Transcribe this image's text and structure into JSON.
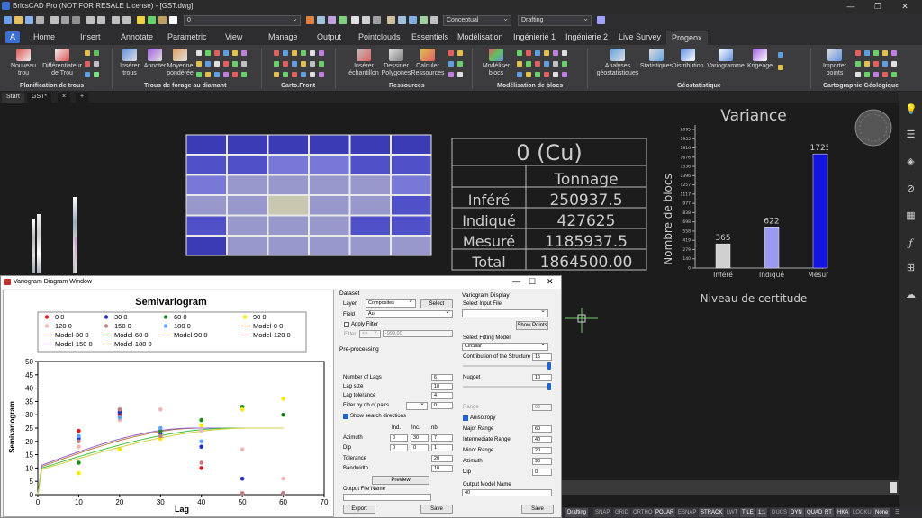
{
  "titlebar": {
    "title": "BricsCAD Pro (NOT FOR RESALE License) - [GST.dwg]"
  },
  "qat": {
    "layer": "0",
    "visual_style": "Conceptual",
    "workspace": "Drafting"
  },
  "tabs": [
    "Home",
    "Insert",
    "Annotate",
    "Parametric",
    "View",
    "Manage",
    "Output",
    "Pointclouds",
    "Essentiels",
    "Modélisation",
    "Ingénierie 1",
    "Ingénierie 2",
    "Live Survey",
    "Progeox"
  ],
  "app_button": "A",
  "ribbon": {
    "buttons": [
      {
        "label": "Nouveau\ntrou"
      },
      {
        "label": "Différentiateur\nde Trou"
      },
      {
        "label": "Insérer\ntrous"
      },
      {
        "label": "Annoter"
      },
      {
        "label": "Moyenne\npondérée"
      },
      {
        "label": "Insérer\néchantillon"
      },
      {
        "label": "Dessiner\nPolygones"
      },
      {
        "label": "Calculer\nRessources"
      },
      {
        "label": "Modéliser\nblocs"
      },
      {
        "label": "Analyses\ngéostatistiques"
      },
      {
        "label": "Statistiques"
      },
      {
        "label": "Distribution"
      },
      {
        "label": "Variogramme"
      },
      {
        "label": "Krigeage"
      },
      {
        "label": "Importer\npoints"
      }
    ],
    "groups": [
      "Planification de trous",
      "Trous de forage au diamant",
      "Carto.Front",
      "Ressources",
      "Modélisation de blocs",
      "Géostatistique",
      "Cartographie Géologique"
    ]
  },
  "doctabs": {
    "start": "Start",
    "active": "GST*",
    "close": "×",
    "add": "+"
  },
  "drawing": {
    "table": {
      "title": "0 (Cu)",
      "header": "Tonnage",
      "rows": [
        {
          "label": "Inféré",
          "value": "250937.5"
        },
        {
          "label": "Indiqué",
          "value": "427625"
        },
        {
          "label": "Mesuré",
          "value": "1185937.5"
        },
        {
          "label": "Total",
          "value": "1864500.00"
        }
      ]
    },
    "variance_chart": {
      "title": "Variance",
      "ylabel": "Nombre de blocs",
      "xlabel": "Niveau de certitude",
      "yticks": [
        "2095",
        "1955",
        "1816",
        "1676",
        "1536",
        "1396",
        "1257",
        "1117",
        "977",
        "838",
        "698",
        "558",
        "419",
        "279",
        "140",
        "0"
      ],
      "colors": [
        "#d0d0d0",
        "#9a9af0",
        "#1515e0"
      ],
      "chart_data": {
        "type": "bar",
        "categories": [
          "Inféré",
          "Indiqué",
          "Mesuré"
        ],
        "values": [
          365,
          622,
          1725
        ],
        "title": "Variance",
        "xlabel": "Niveau de certitude",
        "ylabel": "Nombre de blocs",
        "ylim": [
          0,
          2095
        ]
      }
    }
  },
  "rightbar": {
    "icons": [
      "bulb-icon",
      "sliders-icon",
      "cube-icon",
      "paperclip-icon",
      "grid-icon",
      "fx-icon",
      "structure-icon",
      "cloud-icon"
    ]
  },
  "statusbar": {
    "items": [
      "Drafting",
      "SNAP",
      "GRID",
      "ORTHO",
      "POLAR",
      "ESNAP",
      "STRACK",
      "LWT",
      "TILE",
      "1:1",
      "DUCS",
      "DYN",
      "QUAD",
      "RT",
      "HKA",
      "LOCKUI",
      "None"
    ]
  },
  "variogram_window": {
    "title": "Variogram Diagram Window",
    "chart": {
      "title": "Semivariogram",
      "xlabel": "Lag",
      "ylabel": "Semivariogram",
      "legend": [
        {
          "name": "0 0",
          "color": "#e41a1c",
          "kind": "dot"
        },
        {
          "name": "30 0",
          "color": "#1f2fd0",
          "kind": "dot"
        },
        {
          "name": "60 0",
          "color": "#1a8a1a",
          "kind": "dot"
        },
        {
          "name": "90 0",
          "color": "#ffe800",
          "kind": "dot"
        },
        {
          "name": "120 0",
          "color": "#f4b4b4",
          "kind": "dot"
        },
        {
          "name": "150 0",
          "color": "#c08080",
          "kind": "dot"
        },
        {
          "name": "180 0",
          "color": "#60a0ff",
          "kind": "dot"
        },
        {
          "name": "Model-0 0",
          "color": "#c08040",
          "kind": "line"
        },
        {
          "name": "Model-30 0",
          "color": "#9060d0",
          "kind": "line"
        },
        {
          "name": "Model-60 0",
          "color": "#40c040",
          "kind": "line"
        },
        {
          "name": "Model-90 0",
          "color": "#d0d040",
          "kind": "line"
        },
        {
          "name": "Model-120 0",
          "color": "#f0a0a0",
          "kind": "line"
        },
        {
          "name": "Model-150 0",
          "color": "#c0a0e0",
          "kind": "line"
        },
        {
          "name": "Model-180 0",
          "color": "#a0a040",
          "kind": "line"
        }
      ],
      "chart_data": {
        "type": "scatter",
        "title": "Semivariogram",
        "xlabel": "Lag",
        "ylabel": "Semivariogram",
        "xlim": [
          0,
          70
        ],
        "ylim": [
          0,
          50
        ],
        "xticks": [
          0,
          10,
          20,
          30,
          40,
          50,
          60,
          70
        ],
        "yticks": [
          0,
          5,
          10,
          15,
          20,
          25,
          30,
          35,
          40,
          45,
          50
        ],
        "series": [
          {
            "name": "0 0",
            "color": "#e41a1c",
            "points": [
              [
                10,
                24
              ],
              [
                20,
                30
              ],
              [
                30,
                21
              ],
              [
                40,
                10
              ],
              [
                50,
                0.5
              ],
              [
                60,
                0.5
              ]
            ]
          },
          {
            "name": "30 0",
            "color": "#1f2fd0",
            "points": [
              [
                10,
                21
              ],
              [
                20,
                31
              ],
              [
                30,
                23
              ],
              [
                40,
                18
              ],
              [
                50,
                6
              ],
              [
                60,
                0.5
              ]
            ]
          },
          {
            "name": "60 0",
            "color": "#1a8a1a",
            "points": [
              [
                10,
                12
              ],
              [
                20,
                17
              ],
              [
                30,
                24
              ],
              [
                40,
                28
              ],
              [
                50,
                33
              ],
              [
                60,
                30
              ]
            ]
          },
          {
            "name": "90 0",
            "color": "#ffe800",
            "points": [
              [
                10,
                8
              ],
              [
                20,
                17
              ],
              [
                30,
                21
              ],
              [
                40,
                26
              ],
              [
                50,
                32
              ],
              [
                60,
                36
              ]
            ]
          },
          {
            "name": "120 0",
            "color": "#f4b4b4",
            "points": [
              [
                10,
                18
              ],
              [
                20,
                28
              ],
              [
                30,
                32
              ],
              [
                40,
                24
              ],
              [
                50,
                17
              ],
              [
                60,
                6
              ]
            ]
          },
          {
            "name": "150 0",
            "color": "#c08080",
            "points": [
              [
                10,
                20
              ],
              [
                20,
                32
              ],
              [
                30,
                22
              ],
              [
                40,
                12
              ],
              [
                50,
                0.5
              ],
              [
                60,
                0.5
              ]
            ]
          },
          {
            "name": "180 0",
            "color": "#60a0ff",
            "points": [
              [
                10,
                22
              ],
              [
                20,
                29
              ],
              [
                30,
                25
              ],
              [
                40,
                20
              ]
            ]
          }
        ],
        "models": [
          {
            "name": "Model-0 0",
            "color": "#c08040",
            "sill": 25,
            "range": 40,
            "nugget": 10
          },
          {
            "name": "Model-30 0",
            "color": "#9060d0",
            "sill": 25,
            "range": 38,
            "nugget": 10.5
          },
          {
            "name": "Model-60 0",
            "color": "#40c040",
            "sill": 25,
            "range": 48,
            "nugget": 9.5
          },
          {
            "name": "Model-90 0",
            "color": "#d0d040",
            "sill": 25,
            "range": 52,
            "nugget": 9
          }
        ]
      }
    },
    "dataset": {
      "section": "Dataset",
      "layer_label": "Layer",
      "layer_value": "Composites",
      "select_button": "Select",
      "field_label": "Field",
      "field_value": "Au",
      "apply_filter": "Apply Filter",
      "filter_label": "Filter",
      "filter_op": "<=",
      "filter_value": "-999.00"
    },
    "preprocessing": {
      "section": "Pre-processing",
      "rows": [
        {
          "label": "Number of Lags",
          "value": "6"
        },
        {
          "label": "Lag size",
          "value": "10"
        },
        {
          "label": "Lag tolerance",
          "value": "4"
        },
        {
          "label": "Filter by nb of pairs",
          "value": "0"
        }
      ],
      "show_search": "Show search directions",
      "col_headers": [
        "Ind.",
        "Inc.",
        "nb"
      ],
      "azimuth": {
        "label": "Azimuth",
        "values": [
          "0",
          "30",
          "7"
        ]
      },
      "dip": {
        "label": "Dip",
        "values": [
          "0",
          "0",
          "1"
        ]
      },
      "tolerance": {
        "label": "Tolerance",
        "value": "20"
      },
      "bandwidth": {
        "label": "Bandwidth",
        "value": "10"
      },
      "preview_button": "Preview",
      "output_file_label": "Output File Name",
      "export_button": "Export",
      "save_button": "Save"
    },
    "display": {
      "section": "Variogram Display",
      "input_label": "Select Input File",
      "show_points": "Show Points",
      "fitting_label": "Select Fitting Model",
      "fitting_value": "Circular",
      "contribution_label": "Contribution of the Structure",
      "contribution_value": "15",
      "nugget_label": "Nugget",
      "nugget_value": "10",
      "range_label": "Range",
      "range_value": "60",
      "anisotropy": "Anisotropy",
      "major_label": "Major Range",
      "major_value": "60",
      "intermediate_label": "Intermediate Range",
      "intermediate_value": "40",
      "minor_label": "Minor Range",
      "minor_value": "20",
      "azimuth_label": "Azimuth",
      "azimuth_value": "90",
      "dip_label": "Dip",
      "dip_value": "0",
      "output_model_label": "Output Model Name",
      "output_model_value": "40",
      "save_button": "Save"
    }
  }
}
